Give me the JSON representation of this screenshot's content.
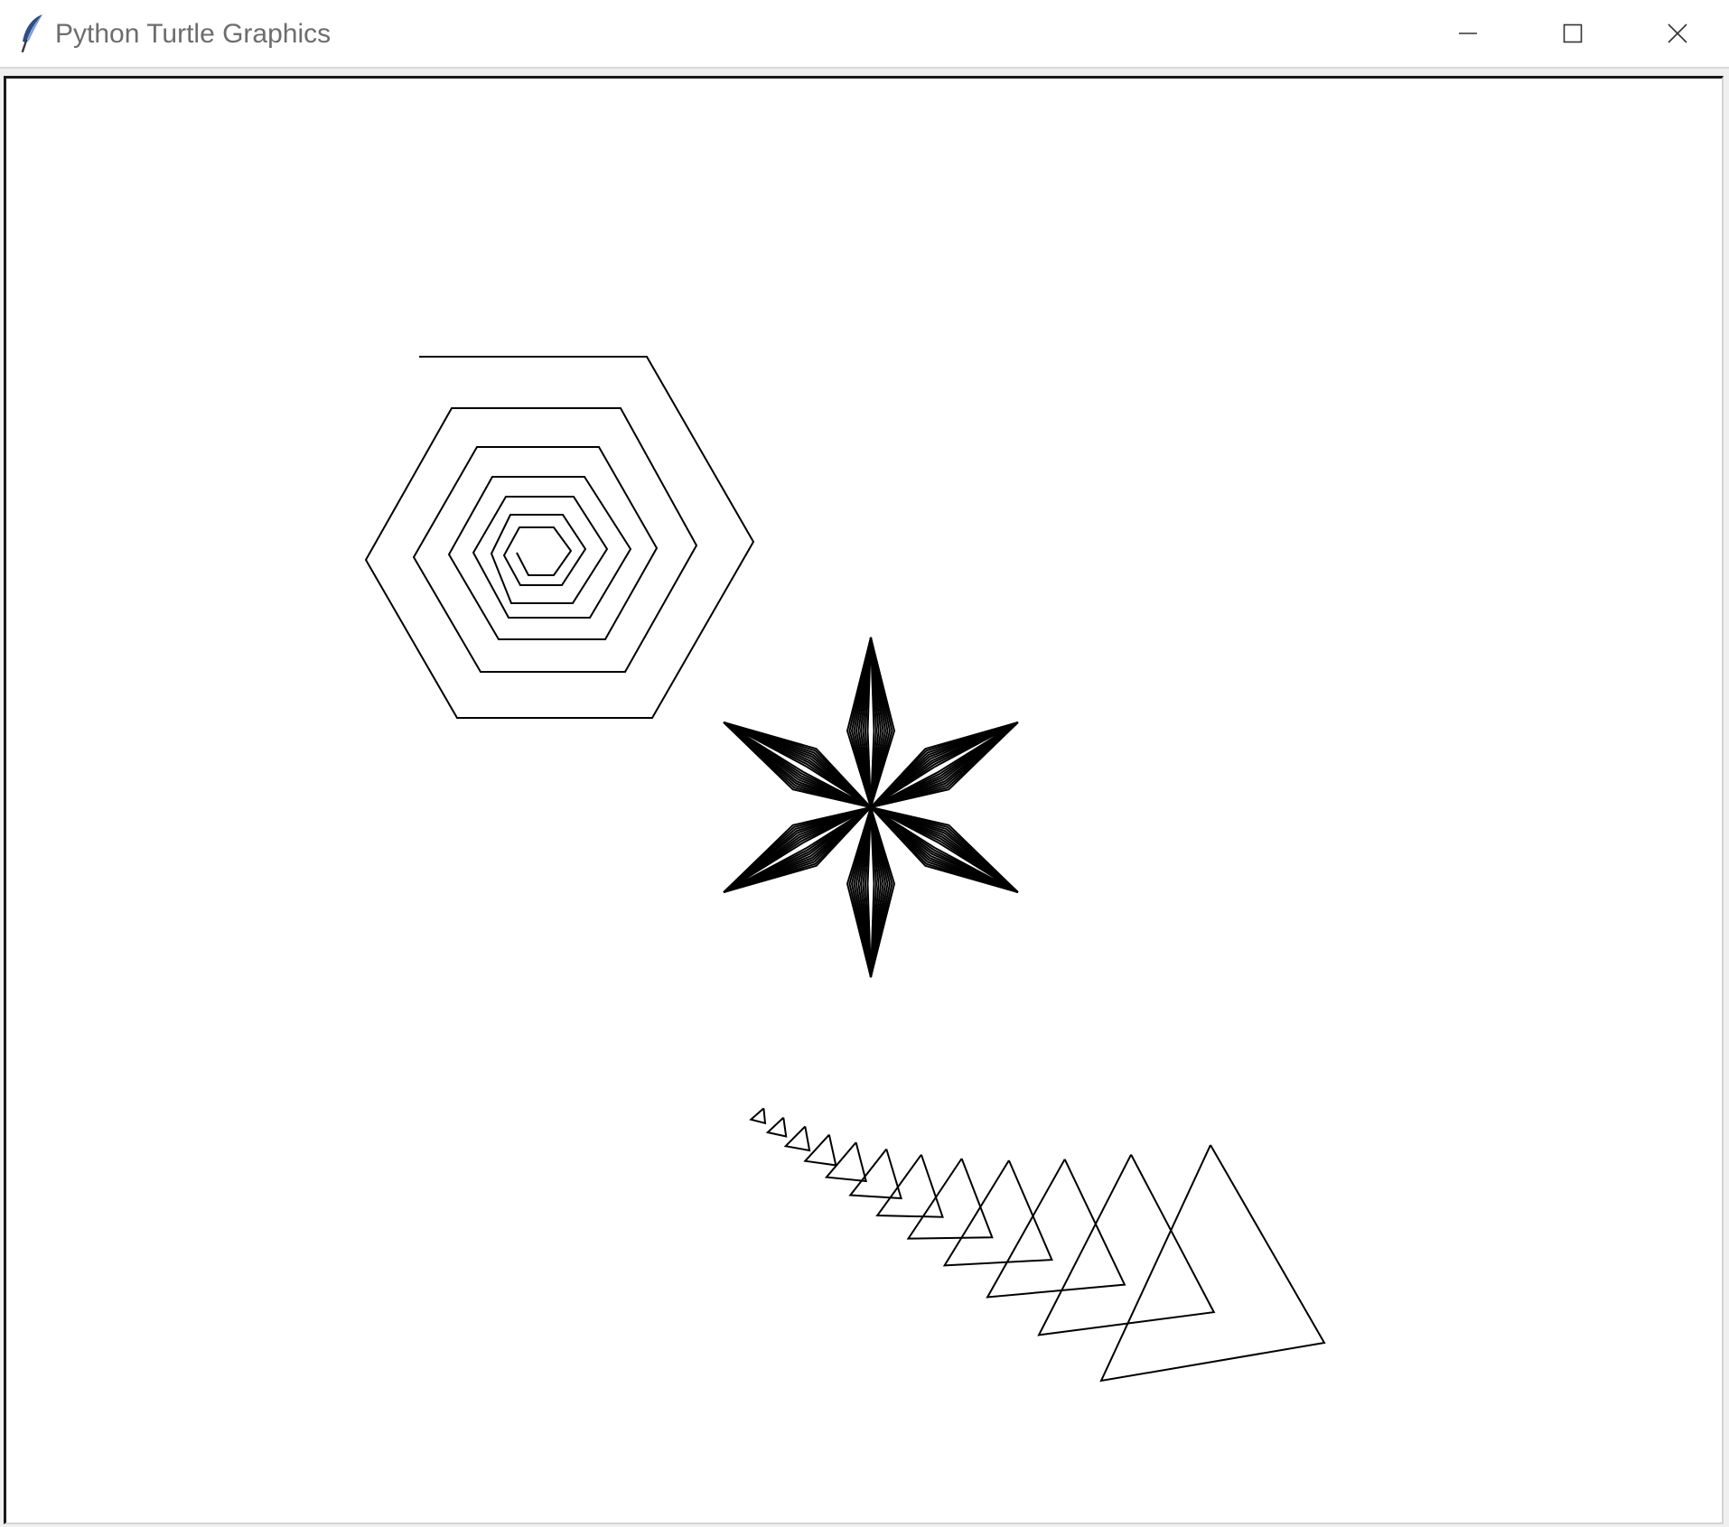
{
  "window": {
    "title": "Python Turtle Graphics",
    "app_icon": "feather-icon",
    "controls": {
      "minimize_icon": "minimize-icon",
      "maximize_icon": "maximize-icon",
      "close_icon": "close-icon"
    }
  },
  "canvas": {
    "background": "#ffffff",
    "pen_color": "#000000",
    "drawings": [
      {
        "name": "hexagon-spiral",
        "shape": "hexagon",
        "pattern": "spiral"
      },
      {
        "name": "six-petal-flower",
        "shape": "petal",
        "petal_count": 6
      },
      {
        "name": "triangle-sequence",
        "shape": "triangle",
        "pattern": "shrinking-rotating"
      }
    ]
  }
}
